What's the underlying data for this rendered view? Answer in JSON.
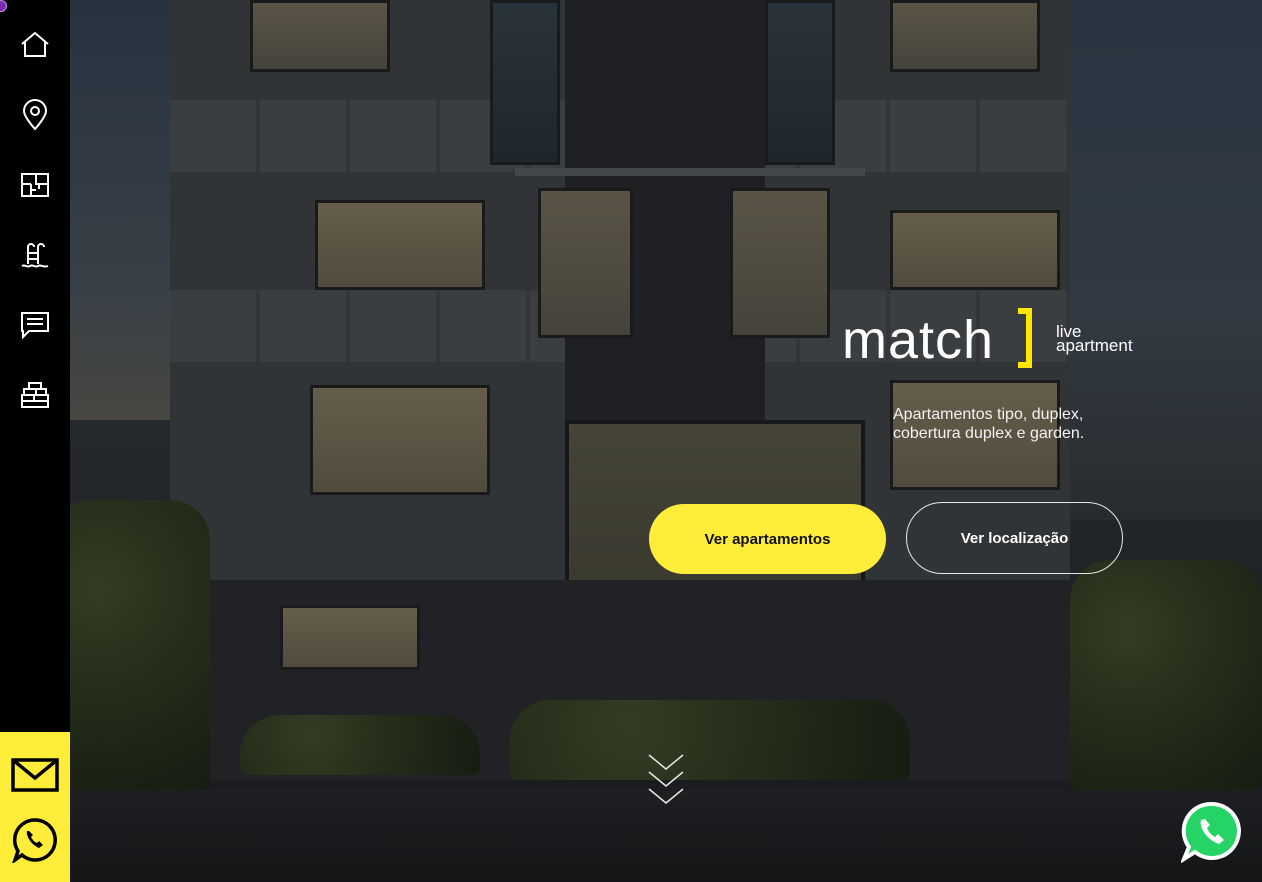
{
  "sidebar": {
    "items": [
      {
        "icon": "home-icon",
        "label": "Home"
      },
      {
        "icon": "location-pin-icon",
        "label": "Localização"
      },
      {
        "icon": "floor-plan-icon",
        "label": "Plantas"
      },
      {
        "icon": "pool-ladder-icon",
        "label": "Lazer"
      },
      {
        "icon": "chat-icon",
        "label": "Contato"
      },
      {
        "icon": "bricks-icon",
        "label": "Obras"
      }
    ],
    "contact": [
      {
        "icon": "mail-icon"
      },
      {
        "icon": "whatsapp-icon"
      }
    ]
  },
  "hero": {
    "logo": {
      "word": "match",
      "sub_line1": "live",
      "sub_line2": "apartment"
    },
    "tagline_line1": "Apartamentos tipo, duplex,",
    "tagline_line2": "cobertura duplex e garden.",
    "cta_primary": "Ver apartamentos",
    "cta_secondary": "Ver localização",
    "scroll_icon": "chevrons-down-icon"
  },
  "floating": {
    "whatsapp_icon": "whatsapp-icon"
  },
  "colors": {
    "accent": "#ffed3a",
    "sidebar": "#000000",
    "whatsapp": "#25d366"
  }
}
